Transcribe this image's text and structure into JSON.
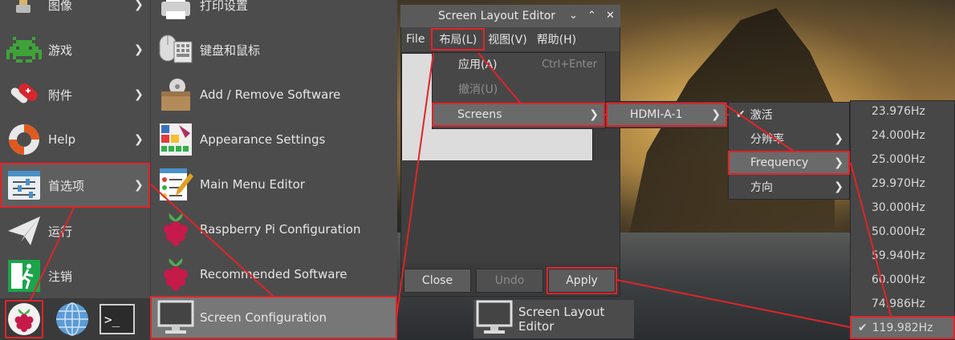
{
  "main_menu": {
    "categories": [
      {
        "label": "图像",
        "icon": "paintbrush-icon"
      },
      {
        "label": "游戏",
        "icon": "space-invader-icon"
      },
      {
        "label": "附件",
        "icon": "swiss-knife-icon"
      },
      {
        "label": "Help",
        "icon": "lifebuoy-icon"
      },
      {
        "label": "首选项",
        "icon": "preferences-sliders-icon"
      },
      {
        "label": "运行",
        "icon": "paper-plane-icon"
      },
      {
        "label": "注销",
        "icon": "exit-icon"
      }
    ],
    "preferences_items": [
      {
        "label": "打印设置",
        "icon": "printer-icon"
      },
      {
        "label": "键盘和鼠标",
        "icon": "keyboard-mouse-icon"
      },
      {
        "label": "Add / Remove Software",
        "icon": "software-box-icon"
      },
      {
        "label": "Appearance Settings",
        "icon": "appearance-palette-icon"
      },
      {
        "label": "Main Menu Editor",
        "icon": "menu-editor-icon"
      },
      {
        "label": "Raspberry Pi Configuration",
        "icon": "raspberry-icon"
      },
      {
        "label": "Recommended Software",
        "icon": "raspberry-icon"
      },
      {
        "label": "Screen Configuration",
        "icon": "monitor-icon"
      }
    ]
  },
  "taskbar": {
    "items": [
      {
        "name": "raspberry-menu",
        "icon": "raspberry-icon"
      },
      {
        "name": "web-browser",
        "icon": "globe-icon"
      },
      {
        "name": "terminal",
        "icon": "terminal-icon",
        "glyph": ">_"
      }
    ],
    "task_label": "Screen Layout Editor"
  },
  "window": {
    "title": "Screen Layout Editor",
    "menubar": [
      "File",
      "布局(L)",
      "视图(V)",
      "帮助(H)"
    ],
    "buttons": {
      "close": "Close",
      "undo": "Undo",
      "apply": "Apply"
    }
  },
  "layout_menu": {
    "items": [
      {
        "label": "应用(A)",
        "accel": "Ctrl+Enter",
        "disabled": false
      },
      {
        "label": "撤消(U)",
        "accel": "",
        "disabled": true
      },
      {
        "label": "Screens",
        "accel": "",
        "disabled": false
      }
    ]
  },
  "screens_menu": {
    "items": [
      {
        "label": "HDMI-A-1"
      }
    ]
  },
  "output_menu": {
    "items": [
      {
        "label": "激活",
        "checked": true
      },
      {
        "label": "分辨率"
      },
      {
        "label": "Frequency"
      },
      {
        "label": "方向"
      }
    ]
  },
  "frequency_menu": {
    "items": [
      "23.976Hz",
      "24.000Hz",
      "25.000Hz",
      "29.970Hz",
      "30.000Hz",
      "50.000Hz",
      "59.940Hz",
      "60.000Hz",
      "74.986Hz",
      "119.982Hz"
    ],
    "selected": "119.982Hz"
  },
  "colors": {
    "highlight_outline": "#e0242a",
    "menu_bg": "#4c4c4c"
  }
}
